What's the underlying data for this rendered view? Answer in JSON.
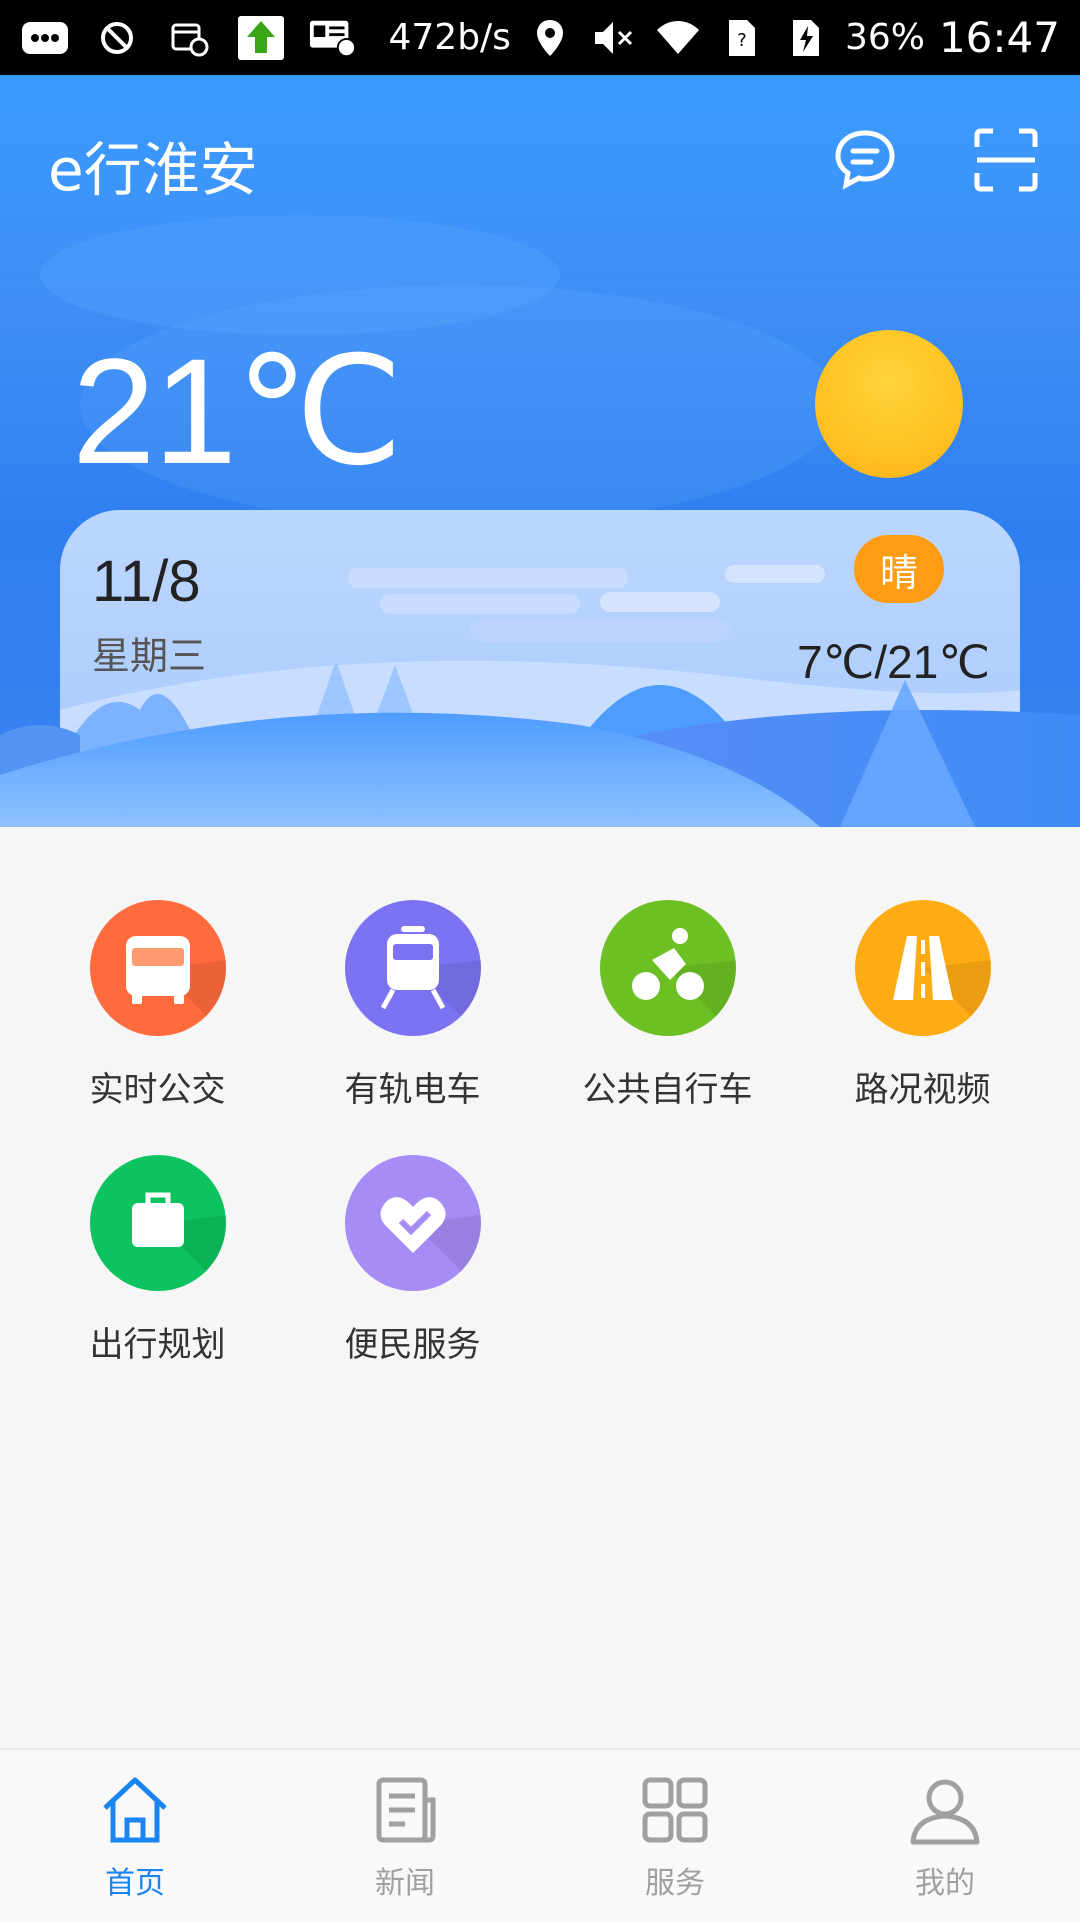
{
  "status_bar": {
    "net_speed": "472b/s",
    "battery": "36%",
    "time": "16:47"
  },
  "header": {
    "title": "e行淮安",
    "message_icon": "chat-bubble-icon",
    "scan_icon": "scan-icon"
  },
  "weather": {
    "temperature": "21℃",
    "date": "11/8",
    "weekday": "星期三",
    "condition": "晴",
    "range": "7℃/21℃"
  },
  "services": [
    {
      "label": "实时公交",
      "icon": "bus-icon",
      "color": "#ff6b3d"
    },
    {
      "label": "有轨电车",
      "icon": "tram-icon",
      "color": "#7b73f2"
    },
    {
      "label": "公共自行车",
      "icon": "bicycle-icon",
      "color": "#6cc024"
    },
    {
      "label": "路况视频",
      "icon": "road-icon",
      "color": "#ffab14"
    },
    {
      "label": "出行规划",
      "icon": "suitcase-icon",
      "color": "#0dc35f"
    },
    {
      "label": "便民服务",
      "icon": "heart-icon",
      "color": "#a68cf5"
    }
  ],
  "bottom_nav": [
    {
      "label": "首页",
      "icon": "home-icon",
      "active": true
    },
    {
      "label": "新闻",
      "icon": "news-icon",
      "active": false
    },
    {
      "label": "服务",
      "icon": "grid-icon",
      "active": false
    },
    {
      "label": "我的",
      "icon": "user-icon",
      "active": false
    }
  ],
  "colors": {
    "accent": "#1a84f0",
    "inactive": "#a0a0a0",
    "condition_badge": "#ff9c14"
  }
}
